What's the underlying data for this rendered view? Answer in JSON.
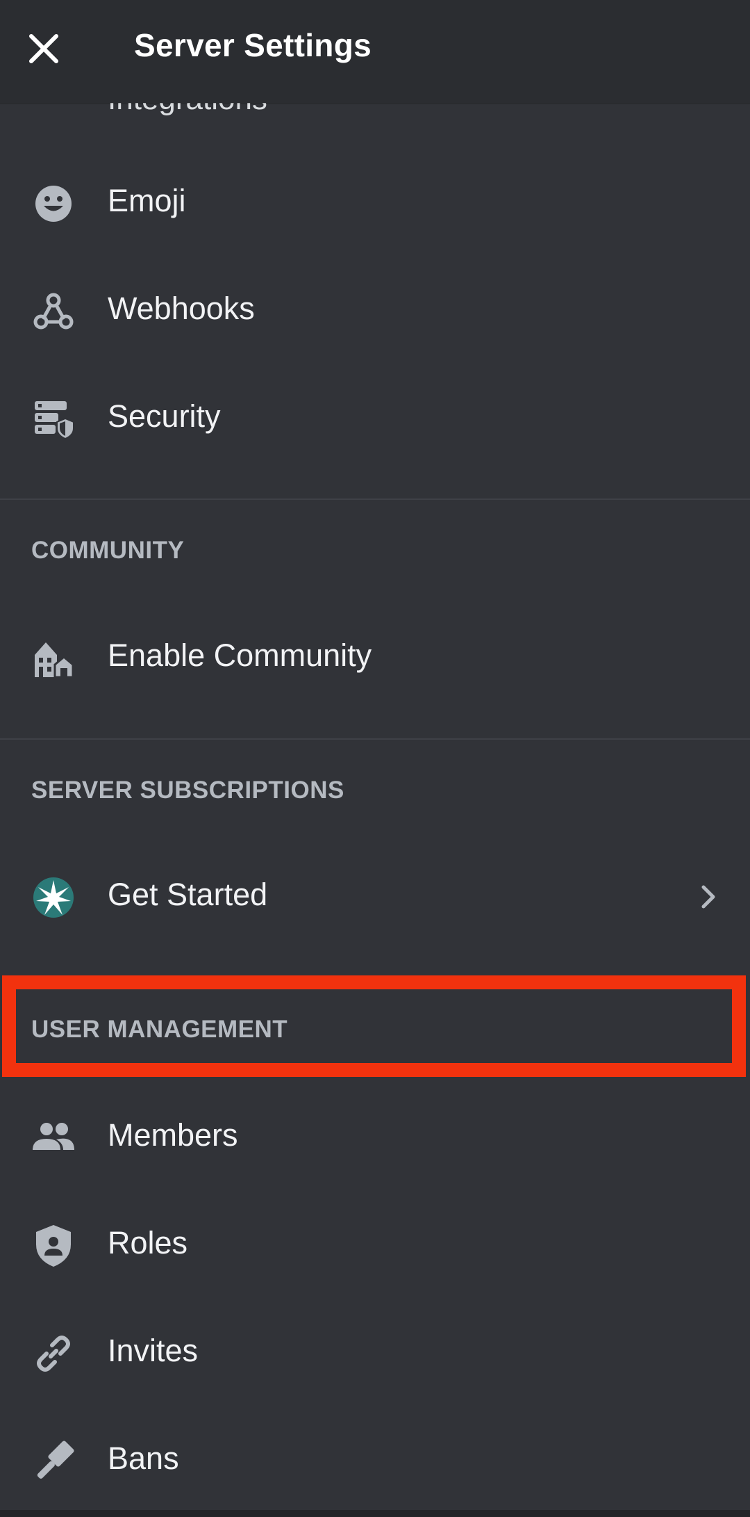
{
  "header": {
    "title": "Server Settings"
  },
  "partial_item": {
    "label": "Integrations"
  },
  "items_top": [
    {
      "label": "Emoji",
      "icon": "emoji-icon"
    },
    {
      "label": "Webhooks",
      "icon": "webhooks-icon"
    },
    {
      "label": "Security",
      "icon": "security-icon"
    }
  ],
  "sections": {
    "community": {
      "header": "COMMUNITY",
      "items": [
        {
          "label": "Enable Community",
          "icon": "community-icon"
        }
      ]
    },
    "subscriptions": {
      "header": "SERVER SUBSCRIPTIONS",
      "items": [
        {
          "label": "Get Started",
          "icon": "subscription-star-icon"
        }
      ]
    },
    "user_management": {
      "header": "USER MANAGEMENT",
      "items": [
        {
          "label": "Members",
          "icon": "members-icon"
        },
        {
          "label": "Roles",
          "icon": "roles-shield-icon"
        },
        {
          "label": "Invites",
          "icon": "invite-link-icon"
        },
        {
          "label": "Bans",
          "icon": "ban-hammer-icon"
        }
      ]
    }
  },
  "colors": {
    "background": "#313338",
    "header_bg": "#2b2d31",
    "icon": "#b5bac1",
    "section_text": "#b5bac1",
    "highlight": "#f2320e",
    "subscription_teal": "#2b7a78"
  }
}
